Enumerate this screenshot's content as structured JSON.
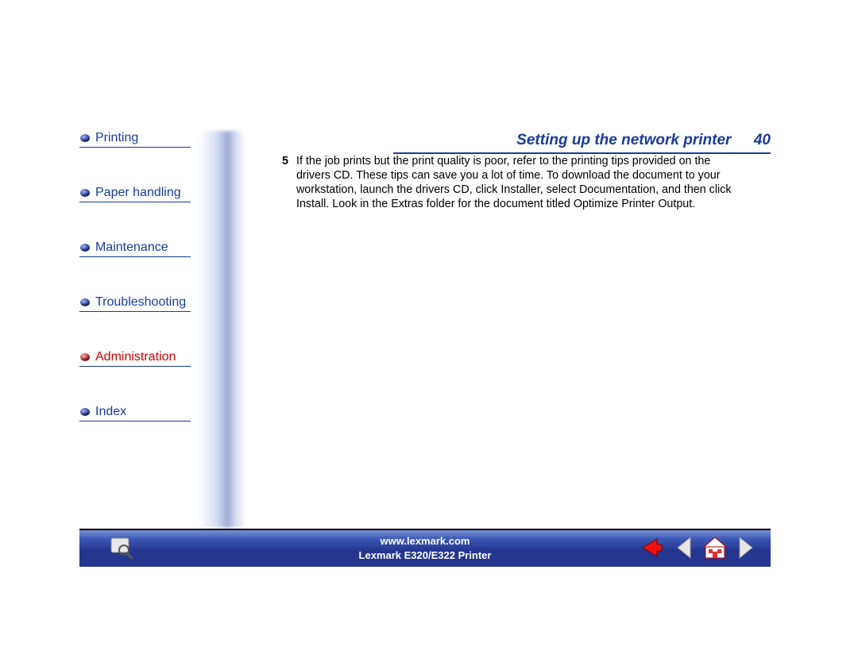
{
  "header": {
    "title": "Setting up the network printer",
    "page_number": "40"
  },
  "sidebar": {
    "items": [
      {
        "label": "Printing",
        "color": "blue"
      },
      {
        "label": "Paper handling",
        "color": "blue"
      },
      {
        "label": "Maintenance",
        "color": "blue"
      },
      {
        "label": "Troubleshooting",
        "color": "blue"
      },
      {
        "label": "Administration",
        "color": "red"
      },
      {
        "label": "Index",
        "color": "blue"
      }
    ]
  },
  "body": {
    "step_number": "5",
    "step_text": "If the job prints but the print quality is poor, refer to the printing tips provided on the drivers CD. These tips can save you a lot of time. To download the document to your workstation, launch the drivers CD, click Installer, select Documentation, and then click Install. Look in the Extras folder for the document titled Optimize Printer Output."
  },
  "footer": {
    "url": "www.lexmark.com",
    "product": "Lexmark E320/E322 Printer"
  }
}
